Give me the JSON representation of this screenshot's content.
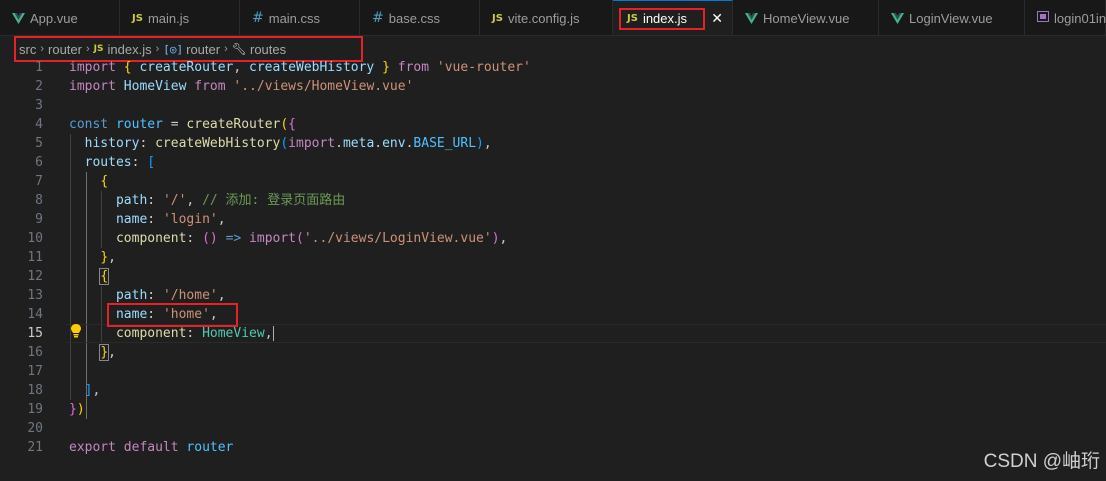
{
  "tabs": [
    {
      "label": "App.vue",
      "icon": "vue-icon"
    },
    {
      "label": "main.js",
      "icon": "js-icon"
    },
    {
      "label": "main.css",
      "icon": "css-icon"
    },
    {
      "label": "base.css",
      "icon": "css-icon"
    },
    {
      "label": "vite.config.js",
      "icon": "js-icon"
    },
    {
      "label": "index.js",
      "icon": "js-icon",
      "active": true
    },
    {
      "label": "HomeView.vue",
      "icon": "vue-icon"
    },
    {
      "label": "LoginView.vue",
      "icon": "vue-icon"
    },
    {
      "label": "login01in",
      "icon": "file-icon"
    }
  ],
  "tab_icons": {
    "js": "JS",
    "css": "#",
    "close": "✕"
  },
  "breadcrumb": {
    "items": [
      "src",
      "router",
      "index.js",
      "router",
      "routes"
    ],
    "separator": "›"
  },
  "code_lines": [
    "import { createRouter, createWebHistory } from 'vue-router'",
    "import HomeView from '../views/HomeView.vue'",
    "",
    "const router = createRouter({",
    "  history: createWebHistory(import.meta.env.BASE_URL),",
    "  routes: [",
    "    {",
    "      path: '/', // 添加: 登录页面路由",
    "      name: 'login',",
    "      component: () => import('../views/LoginView.vue'),",
    "    },",
    "    {",
    "      path: '/home',",
    "      name: 'home',",
    "      component: HomeView,",
    "    },",
    "",
    "  ],",
    "})",
    "",
    "export default router"
  ],
  "current_line": 15,
  "watermark": "CSDN @岫珩",
  "colors": {
    "highlight_box": "#e5212a",
    "keyword": "#c586c0",
    "string": "#ce9178",
    "variable": "#9cdcfe",
    "function": "#dcdcaa",
    "comment": "#6a9955",
    "active_tab_border": "#0078d4"
  }
}
